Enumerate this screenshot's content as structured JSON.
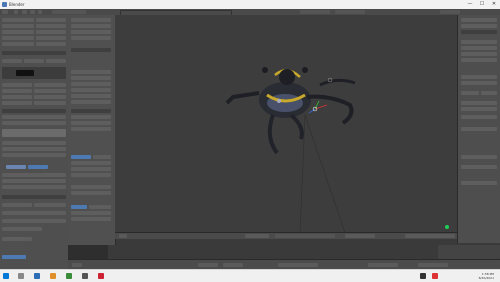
{
  "window": {
    "title": "Blender",
    "minimize_glyph": "—",
    "maximize_glyph": "☐",
    "close_glyph": "✕"
  },
  "menubar": {
    "labels": [
      "File",
      "Render",
      "Window",
      "Help"
    ],
    "scene_label": "Default",
    "render_engine": "Blender Render"
  },
  "viewport": {
    "header_mode": "Object Mode",
    "label_top": "User Persp"
  },
  "rightpanel": {
    "header": "View"
  },
  "taskbar": {
    "time": "1:58 PM",
    "date": "8/30/2021"
  },
  "colors": {
    "accent": "#4e7ab4",
    "panel": "#4f4f4f",
    "viewport_bg": "#3d3d3d",
    "taskbar_bg": "#f0f0f0"
  }
}
